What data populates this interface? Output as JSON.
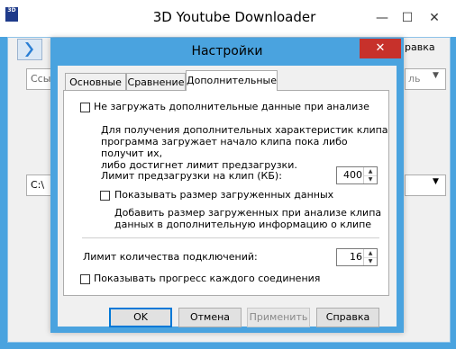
{
  "main_window": {
    "title": "3D Youtube Downloader",
    "app_icon": "3D",
    "minimize_icon": "—",
    "maximize_icon": "☐",
    "close_icon": "✕",
    "url_field_partial": "Ссыл",
    "path_field_partial": "C:\\",
    "right_tab_partial": "равка",
    "right_field_partial": "ль"
  },
  "dialog": {
    "title": "Настройки",
    "close_icon": "✕",
    "tabs": [
      {
        "label": "Основные",
        "active": false
      },
      {
        "label": "Сравнение",
        "active": false
      },
      {
        "label": "Дополнительные",
        "active": true
      }
    ],
    "options": {
      "skip_extra_data": {
        "label": "Не загружать дополнительные данные при анализе",
        "checked": false
      },
      "extra_data_description": [
        "Для получения дополнительных характеристик клипа",
        "программа загружает начало клипа пока либо получит их,",
        "либо достигнет лимит предзагрузки."
      ],
      "preload_limit": {
        "label": "Лимит предзагрузки на клип (КБ):",
        "value": "400"
      },
      "show_loaded_size": {
        "label": "Показывать размер загруженных данных",
        "checked": false
      },
      "loaded_size_description": [
        "Добавить размер загруженных при анализе клипа",
        "данных в дополнительную информацию о клипе"
      ],
      "connection_limit": {
        "label": "Лимит количества подключений:",
        "value": "16"
      },
      "show_connection_progress": {
        "label": "Показывать прогресс каждого соединения",
        "checked": false
      }
    },
    "buttons": {
      "ok": "OK",
      "cancel": "Отмена",
      "apply": "Применить",
      "help": "Справка"
    },
    "spin_up": "▲",
    "spin_down": "▼"
  },
  "colors": {
    "accent": "#4aa3df",
    "close_red": "#c7312b"
  }
}
